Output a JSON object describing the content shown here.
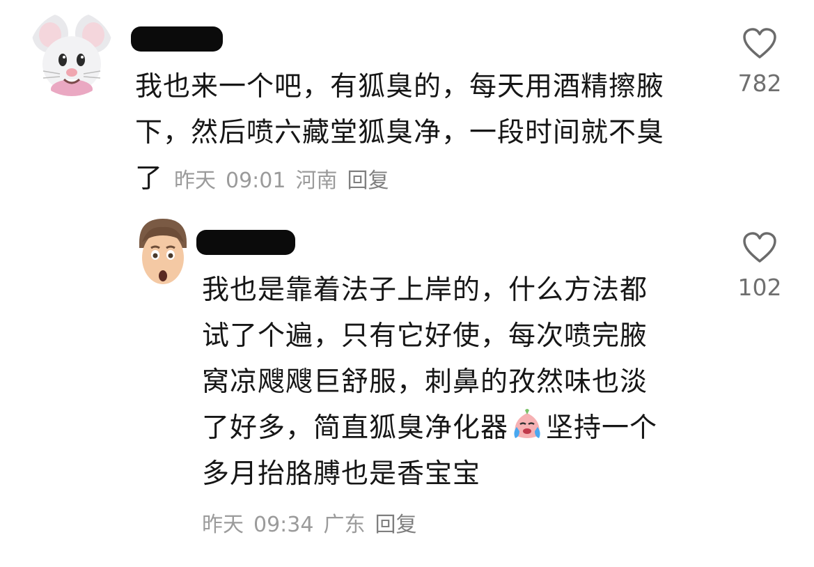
{
  "comments": [
    {
      "text_lines": [
        "我也来一个吧，有狐臭的，每天用酒精擦腋",
        "下，然后喷六藏堂狐臭净，一段时间就不臭",
        "了"
      ],
      "date": "昨天",
      "time": "09:01",
      "location": "河南",
      "reply_label": "回复",
      "likes": "782",
      "avatar_icon": "mouse-memoji-icon"
    },
    {
      "text_lines": [
        "我也是靠着法子上岸的，什么方法都",
        "试了个遍，只有它好使，每次喷完腋",
        "窝凉飕飕巨舒服，刺鼻的孜然味也淡",
        "了好多，简直狐臭净化器",
        "坚持一个",
        "多月抬胳膊也是香宝宝"
      ],
      "date": "昨天",
      "time": "09:34",
      "location": "广东",
      "reply_label": "回复",
      "likes": "102",
      "avatar_icon": "man-memoji-icon",
      "inline_emoji": "crying-face-emoji"
    }
  ]
}
